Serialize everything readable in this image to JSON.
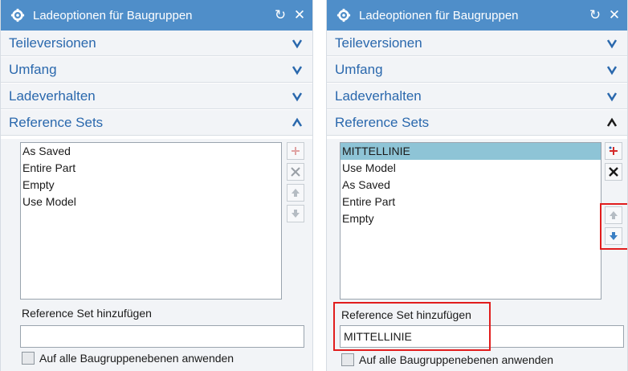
{
  "left_panel": {
    "title": "Ladeoptionen für Baugruppen",
    "reset_icon": "↻",
    "close_icon": "✕",
    "sections": [
      {
        "label": "Teileversionen",
        "state": "collapsed"
      },
      {
        "label": "Umfang",
        "state": "collapsed"
      },
      {
        "label": "Ladeverhalten",
        "state": "collapsed"
      },
      {
        "label": "Reference Sets",
        "state": "expanded"
      }
    ],
    "reference_sets": [
      "As Saved",
      "Entire Part",
      "Empty",
      "Use Model"
    ],
    "add_label": "Reference Set hinzufügen",
    "add_value": "",
    "apply_all_label": "Auf alle Baugruppenebenen anwenden"
  },
  "right_panel": {
    "title": "Ladeoptionen für Baugruppen",
    "reset_icon": "↻",
    "close_icon": "✕",
    "sections": [
      {
        "label": "Teileversionen",
        "state": "collapsed"
      },
      {
        "label": "Umfang",
        "state": "collapsed"
      },
      {
        "label": "Ladeverhalten",
        "state": "collapsed"
      },
      {
        "label": "Reference Sets",
        "state": "expanded"
      }
    ],
    "reference_sets": [
      "MITTELLINIE",
      "Use Model",
      "As Saved",
      "Entire Part",
      "Empty"
    ],
    "selected_item": "MITTELLINIE",
    "add_label": "Reference Set hinzufügen",
    "add_value": "MITTELLINIE",
    "apply_all_label": "Auf alle Baugruppenebenen anwenden"
  },
  "colors": {
    "titlebar": "#4f8ec9",
    "section_text": "#2a68ad",
    "selection": "#8ec4d6",
    "highlight_box": "#e11d1d"
  }
}
